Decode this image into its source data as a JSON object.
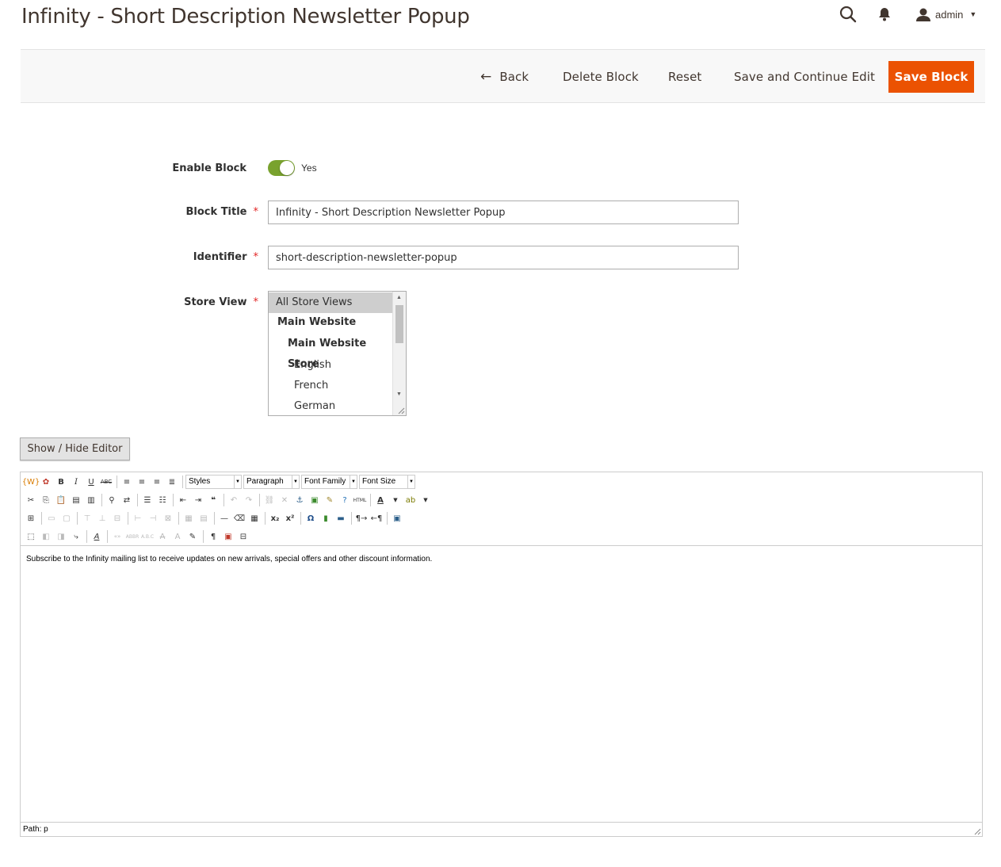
{
  "page": {
    "title": "Infinity - Short Description Newsletter Popup"
  },
  "header": {
    "user": "admin"
  },
  "toolbar": {
    "back": "Back",
    "delete": "Delete Block",
    "reset": "Reset",
    "save_continue": "Save and Continue Edit",
    "save": "Save Block"
  },
  "form": {
    "enable": {
      "label": "Enable Block",
      "value": "Yes",
      "on": true
    },
    "title": {
      "label": "Block Title",
      "value": "Infinity - Short Description Newsletter Popup"
    },
    "identifier": {
      "label": "Identifier",
      "value": "short-description-newsletter-popup"
    },
    "store_view": {
      "label": "Store View",
      "options": [
        "All Store Views",
        "Main Website",
        "Main Website Store",
        "English",
        "French",
        "German"
      ],
      "selected": "All Store Views"
    }
  },
  "editor": {
    "toggle_label": "Show / Hide Editor",
    "selects": {
      "styles": "Styles",
      "paragraph": "Paragraph",
      "font_family": "Font Family",
      "font_size": "Font Size"
    },
    "content": "Subscribe to the Infinity mailing list to receive updates on new arrivals, special offers and other discount information.",
    "path": "Path: p"
  },
  "colors": {
    "accent": "#eb5202",
    "toggle_on": "#79a22e",
    "required": "#e22626"
  }
}
